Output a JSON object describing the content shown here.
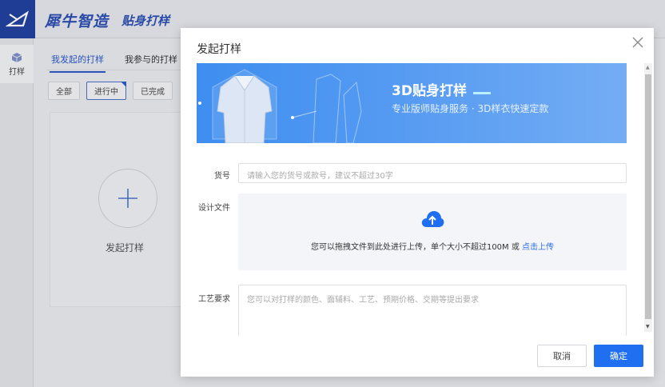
{
  "app": {
    "brand": "犀牛智造",
    "product": "贴身打样"
  },
  "sidebar": {
    "items": [
      {
        "label": "打样",
        "icon": "cube-icon"
      }
    ]
  },
  "main": {
    "tabs": [
      {
        "label": "我发起的打样",
        "active": true
      },
      {
        "label": "我参与的打样",
        "active": false
      }
    ],
    "filters": [
      {
        "label": "全部",
        "active": false
      },
      {
        "label": "进行中",
        "active": true
      },
      {
        "label": "已完成",
        "active": false
      }
    ],
    "new_card_label": "发起打样"
  },
  "dialog": {
    "title": "发起打样",
    "banner": {
      "title": "3D贴身打样",
      "subtitle": "专业版师贴身服务 · 3D样衣快速定款"
    },
    "fields": {
      "item_no": {
        "label": "货号",
        "placeholder": "请输入您的货号或款号，建议不超过30字"
      },
      "design_file": {
        "label": "设计文件",
        "hint": "您可以拖拽文件到此处进行上传，单个大小不超过100M 或 ",
        "link": "点击上传"
      },
      "craft": {
        "label": "工艺要求",
        "placeholder": "您可以对打样的颜色、面辅料、工艺、预期价格、交期等提出要求"
      }
    },
    "buttons": {
      "cancel": "取消",
      "confirm": "确定"
    }
  },
  "colors": {
    "brand_blue": "#1f3f9e",
    "primary": "#1f6ff0",
    "link": "#2d6be4"
  }
}
